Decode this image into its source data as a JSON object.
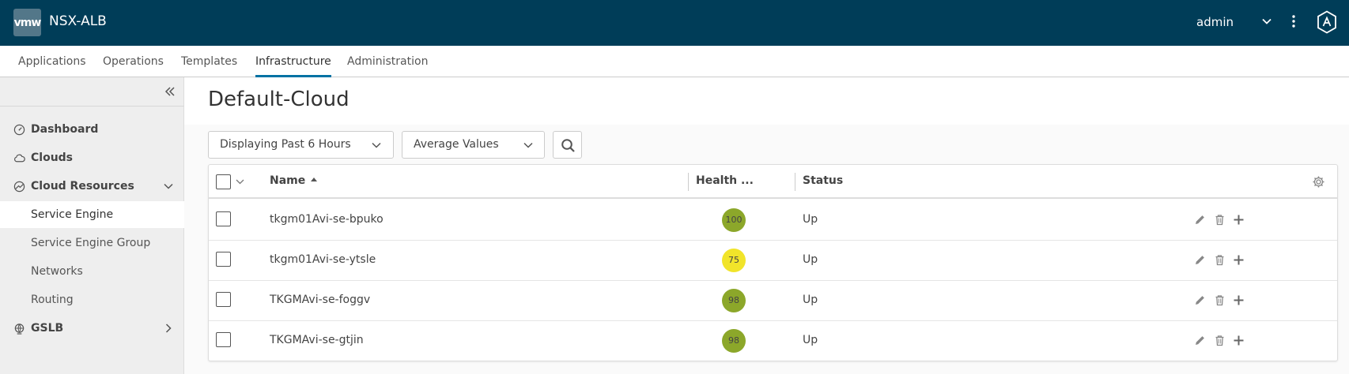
{
  "header": {
    "logo": "vmw",
    "app_name": "NSX-ALB",
    "user": "admin"
  },
  "nav": {
    "tabs": [
      {
        "label": "Applications"
      },
      {
        "label": "Operations"
      },
      {
        "label": "Templates"
      },
      {
        "label": "Infrastructure",
        "active": true
      },
      {
        "label": "Administration"
      }
    ]
  },
  "sidebar": {
    "items": [
      {
        "label": "Dashboard",
        "icon": "dashboard-icon"
      },
      {
        "label": "Clouds",
        "icon": "cloud-icon"
      },
      {
        "label": "Cloud Resources",
        "icon": "cloud-resources-icon",
        "expanded": true
      },
      {
        "label": "Service Engine",
        "active": true
      },
      {
        "label": "Service Engine Group"
      },
      {
        "label": "Networks"
      },
      {
        "label": "Routing"
      },
      {
        "label": "GSLB",
        "icon": "globe-icon"
      }
    ]
  },
  "main": {
    "title": "Default-Cloud",
    "time_range": "Displaying Past 6 Hours",
    "value_mode": "Average Values"
  },
  "table": {
    "columns": {
      "name": "Name",
      "health": "Health ...",
      "status": "Status"
    },
    "rows": [
      {
        "name": "tkgm01Avi-se-bpuko",
        "health": "100",
        "status": "Up"
      },
      {
        "name": "tkgm01Avi-se-ytsle",
        "health": "75",
        "status": "Up"
      },
      {
        "name": "TKGMAvi-se-foggv",
        "health": "98",
        "status": "Up"
      },
      {
        "name": "TKGMAvi-se-gtjin",
        "health": "98",
        "status": "Up"
      }
    ]
  },
  "colors": {
    "header_bg": "#003d58",
    "active_tab": "#0072a3",
    "health_good": "#8ca72a",
    "health_warn": "#f1e42a"
  }
}
